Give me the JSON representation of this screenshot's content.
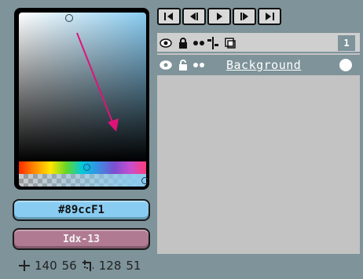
{
  "color_picker": {
    "hex_value": "#89ccF1",
    "index_value": "Idx-13",
    "current_color": "#89ccf1"
  },
  "status_bar": {
    "cursor_x": "140",
    "cursor_y": "56",
    "selection_w": "128",
    "selection_h": "51"
  },
  "animation_toolbar": {
    "buttons": [
      "first-frame-icon",
      "previous-frame-icon",
      "play-icon",
      "next-frame-icon",
      "last-frame-icon"
    ]
  },
  "layers_panel": {
    "header_icons": [
      "eye-icon",
      "lock-icon",
      "continuous-icon",
      "link-icon",
      "new-layer-icon"
    ],
    "frame_number": "1",
    "layers": [
      {
        "name": "Background",
        "visible": true,
        "locked": false
      }
    ]
  },
  "colors": {
    "ui_background": "#7e939a",
    "panel_gray": "#c3c3c3",
    "hex_field": "#89ccf1",
    "index_field": "#b07a92",
    "arrow": "#e0127a"
  }
}
